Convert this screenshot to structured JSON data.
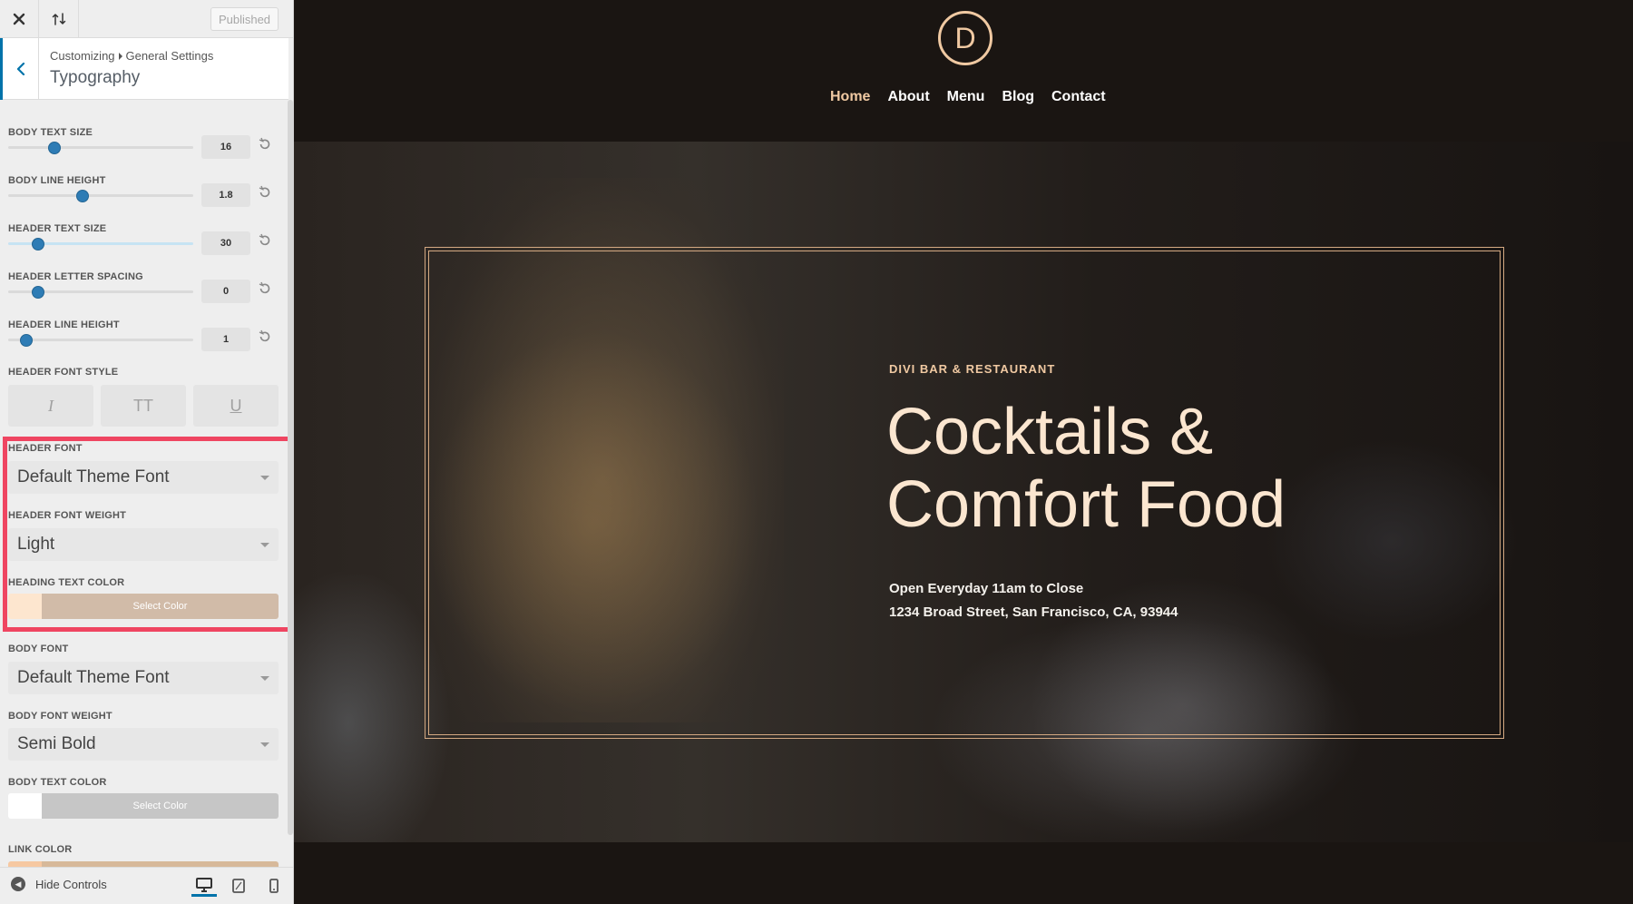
{
  "panel": {
    "status_button": "Published",
    "breadcrumb": [
      "Customizing",
      "General Settings"
    ],
    "section_title": "Typography",
    "sliders": [
      {
        "label": "BODY TEXT SIZE",
        "value": "16",
        "fraction": 0.25
      },
      {
        "label": "BODY LINE HEIGHT",
        "value": "1.8",
        "fraction": 0.4
      },
      {
        "label": "HEADER TEXT SIZE",
        "value": "30",
        "fraction": 0.16
      },
      {
        "label": "HEADER LETTER SPACING",
        "value": "0",
        "fraction": 0.16
      },
      {
        "label": "HEADER LINE HEIGHT",
        "value": "1",
        "fraction": 0.1
      }
    ],
    "header_font_style": {
      "label": "HEADER FONT STYLE",
      "buttons": [
        "I",
        "TT",
        "U"
      ]
    },
    "header_font": {
      "label": "HEADER FONT",
      "value": "Default Theme Font"
    },
    "header_font_weight": {
      "label": "HEADER FONT WEIGHT",
      "value": "Light"
    },
    "heading_text_color": {
      "label": "HEADING TEXT COLOR",
      "button": "Select Color",
      "swatch": "#fde6cf",
      "bar": "#d1bba8"
    },
    "body_font": {
      "label": "BODY FONT",
      "value": "Default Theme Font"
    },
    "body_font_weight": {
      "label": "BODY FONT WEIGHT",
      "value": "Semi Bold"
    },
    "body_text_color": {
      "label": "BODY TEXT COLOR",
      "button": "Select Color",
      "swatch": "#ffffff",
      "bar": "#c6c6c6"
    },
    "link_color": {
      "label": "LINK COLOR",
      "swatch": "#f6c8a1",
      "bar": "#d7b99a"
    },
    "hide_controls": "Hide Controls"
  },
  "site": {
    "logo_letter": "D",
    "nav": [
      "Home",
      "About",
      "Menu",
      "Blog",
      "Contact"
    ],
    "eyebrow": "DIVI BAR & RESTAURANT",
    "headline_line1": "Cocktails &",
    "headline_line2": "Comfort Food",
    "hours": "Open Everyday 11am to Close",
    "address": "1234 Broad Street, San Francisco, CA, 93944"
  },
  "colors": {
    "accent": "#f0c9a2",
    "highlight_border": "#ef4561",
    "slider_thumb": "#2e7cb5"
  }
}
